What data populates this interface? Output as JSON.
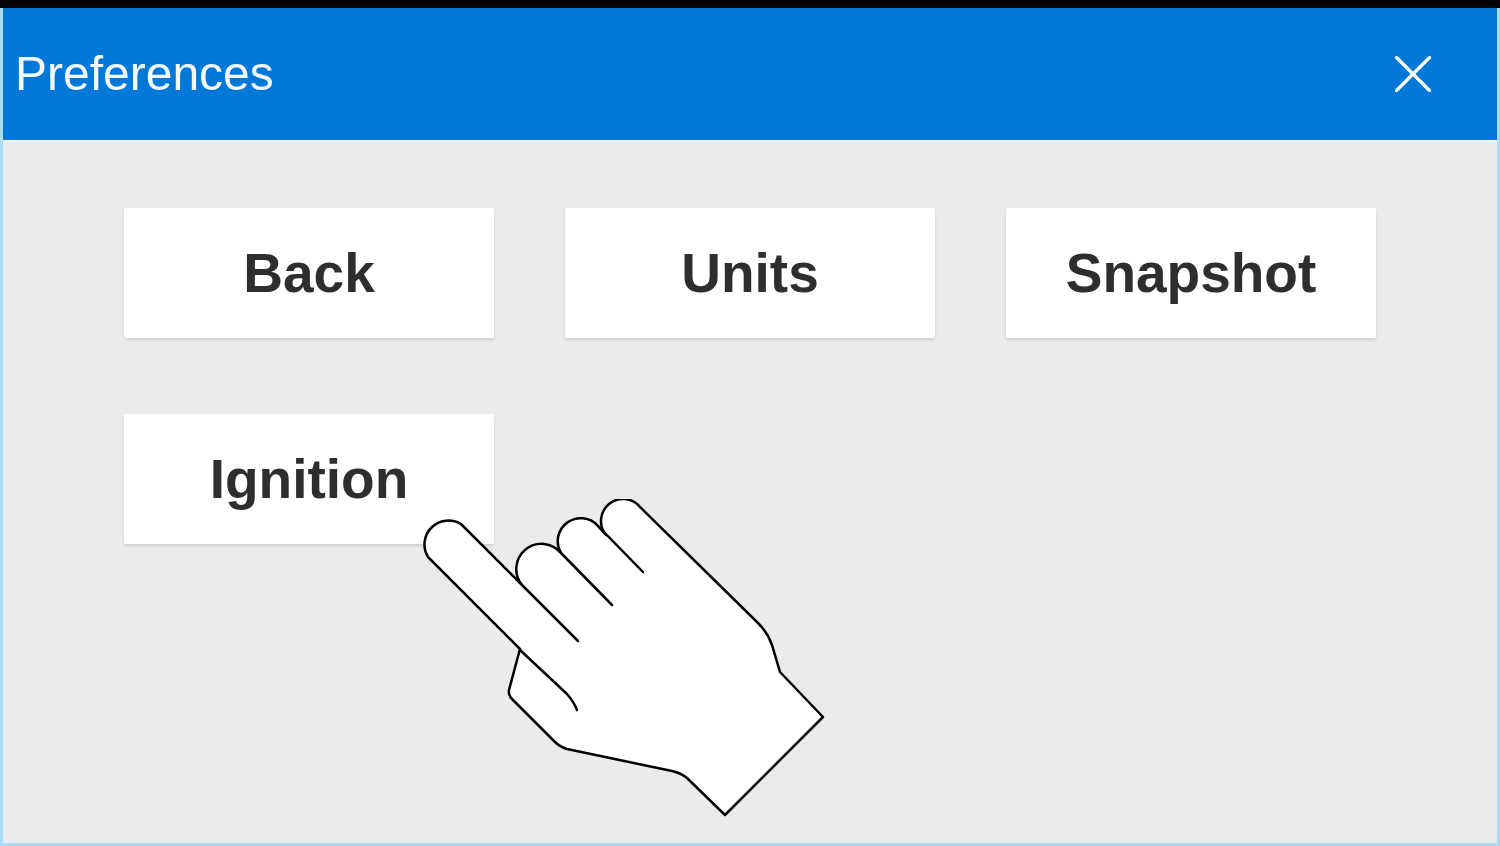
{
  "window": {
    "title": "Preferences"
  },
  "buttons": [
    "Back",
    "Units",
    "Snapshot",
    "Ignition"
  ]
}
